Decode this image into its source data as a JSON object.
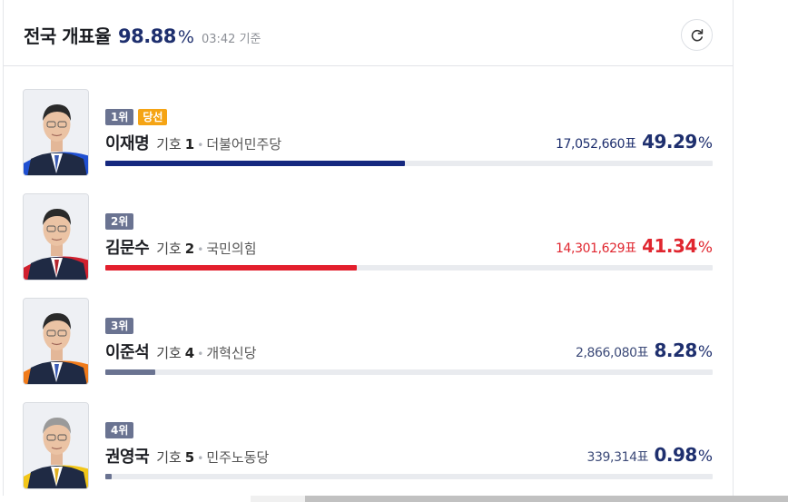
{
  "header": {
    "title": "전국 개표율",
    "rate": "98.88",
    "rate_unit": "%",
    "time": "03:42 기준",
    "refresh_icon": "refresh-icon"
  },
  "labels": {
    "giho": "기호",
    "vote_unit": "표",
    "pct_unit": "%"
  },
  "candidates": [
    {
      "rank": "1위",
      "status": "당선",
      "name": "이재명",
      "number": "1",
      "party": "더불어민주당",
      "votes": "17,052,660",
      "share": "49.29",
      "share_value": 49.29,
      "color": "#1e2f6e",
      "votes_color": "#1e2f6e",
      "bar_color": "#15287f",
      "accent": "#1f4fd1"
    },
    {
      "rank": "2위",
      "status": "",
      "name": "김문수",
      "number": "2",
      "party": "국민의힘",
      "votes": "14,301,629",
      "share": "41.34",
      "share_value": 41.34,
      "color": "#e0262f",
      "votes_color": "#e0262f",
      "bar_color": "#e31f2d",
      "accent": "#d1202e"
    },
    {
      "rank": "3위",
      "status": "",
      "name": "이준석",
      "number": "4",
      "party": "개혁신당",
      "votes": "2,866,080",
      "share": "8.28",
      "share_value": 8.28,
      "color": "#1e2f6e",
      "votes_color": "#3c4a78",
      "bar_color": "#6a7391",
      "accent": "#f07b1b"
    },
    {
      "rank": "4위",
      "status": "",
      "name": "권영국",
      "number": "5",
      "party": "민주노동당",
      "votes": "339,314",
      "share": "0.98",
      "share_value": 0.98,
      "color": "#1e2f6e",
      "votes_color": "#3c4a78",
      "bar_color": "#6a7391",
      "accent": "#f2c619"
    }
  ]
}
